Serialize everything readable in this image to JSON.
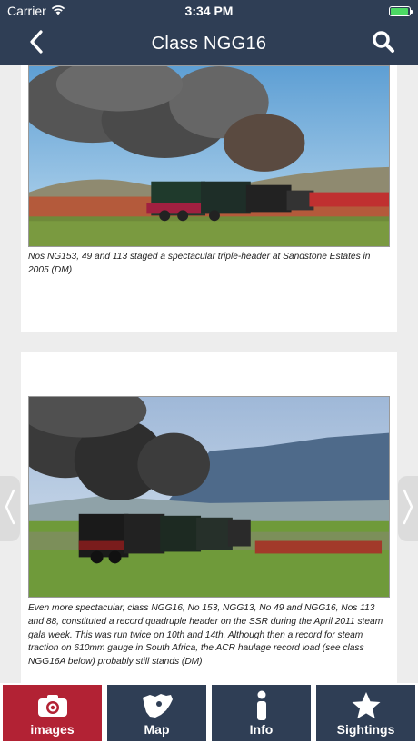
{
  "status_bar": {
    "carrier": "Carrier",
    "time": "3:34 PM",
    "battery_level": 0.95,
    "battery_color": "#4cd964"
  },
  "nav": {
    "title": "Class NGG16",
    "back_icon": "chevron-left-icon",
    "search_icon": "search-icon",
    "background": "#2f3e55"
  },
  "cards": [
    {
      "caption": "Nos NG153, 49 and 113 staged a spectacular triple-header at Sandstone Estates in 2005 (DM)"
    },
    {
      "caption": "Even more spectacular, class NGG16, No 153, NGG13, No 49 and NGG16, Nos 113 and 88, constituted a record quadruple header on the SSR during the April 2011 steam gala week. This was run twice on 10th and 14th. Although then a record for steam traction on 610mm gauge in South Africa, the ACR haulage record load (see class NGG16A below) probably still stands (DM)"
    }
  ],
  "tabs": [
    {
      "label": "images",
      "icon": "camera-icon",
      "active": true
    },
    {
      "label": "Map",
      "icon": "africa-map-icon",
      "active": false
    },
    {
      "label": "Info",
      "icon": "info-icon",
      "active": false
    },
    {
      "label": "Sightings",
      "icon": "star-icon",
      "active": false
    }
  ],
  "colors": {
    "accent_active": "#b22234",
    "tab_background": "#2f3e55"
  }
}
